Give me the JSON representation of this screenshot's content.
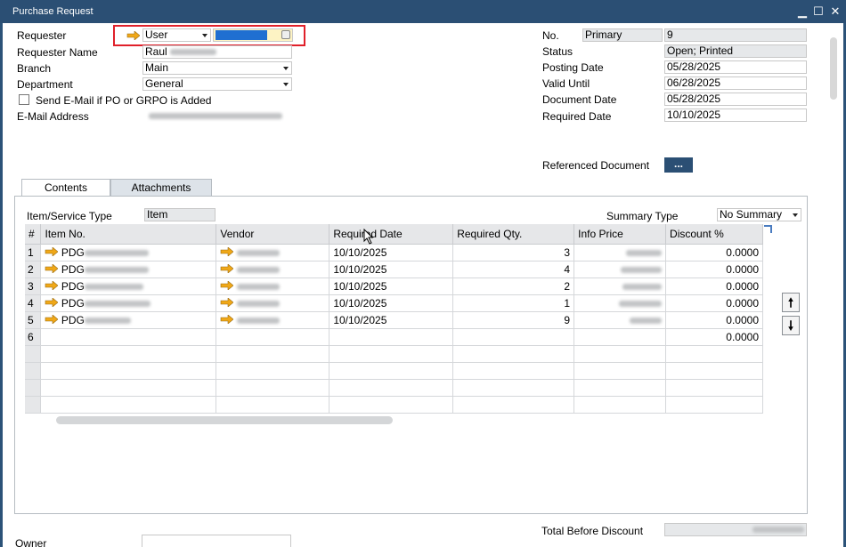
{
  "window": {
    "title": "Purchase Request",
    "minimize": "▁",
    "maximize": "☐",
    "close": "✕"
  },
  "header_left": {
    "requester_label": "Requester",
    "requester_type": "User",
    "requester_name_label": "Requester Name",
    "requester_name": "Raul",
    "branch_label": "Branch",
    "branch": "Main",
    "department_label": "Department",
    "department": "General",
    "send_email_label": "Send E-Mail if PO or GRPO is Added",
    "email_label": "E-Mail Address"
  },
  "header_right": {
    "no_label": "No.",
    "series": "Primary",
    "no": "9",
    "status_label": "Status",
    "status": "Open; Printed",
    "posting_date_label": "Posting Date",
    "posting_date": "05/28/2025",
    "valid_until_label": "Valid Until",
    "valid_until": "06/28/2025",
    "document_date_label": "Document Date",
    "document_date": "05/28/2025",
    "required_date_label": "Required Date",
    "required_date": "10/10/2025",
    "ref_doc_label": "Referenced Document",
    "ref_doc_button": "..."
  },
  "tabs": [
    {
      "label": "Contents"
    },
    {
      "label": "Attachments"
    }
  ],
  "contents": {
    "item_type_label": "Item/Service Type",
    "item_type": "Item",
    "summary_type_label": "Summary Type",
    "summary_type": "No Summary",
    "columns": [
      "#",
      "Item No.",
      "Vendor",
      "Required Date",
      "Required Qty.",
      "Info Price",
      "Discount %"
    ],
    "rows": [
      {
        "n": "1",
        "item": "PDG",
        "date": "10/10/2025",
        "qty": "3",
        "discount": "0.0000"
      },
      {
        "n": "2",
        "item": "PDG",
        "date": "10/10/2025",
        "qty": "4",
        "discount": "0.0000"
      },
      {
        "n": "3",
        "item": "PDG",
        "date": "10/10/2025",
        "qty": "2",
        "discount": "0.0000"
      },
      {
        "n": "4",
        "item": "PDG",
        "date": "10/10/2025",
        "qty": "1",
        "discount": "0.0000"
      },
      {
        "n": "5",
        "item": "PDG",
        "date": "10/10/2025",
        "qty": "9",
        "discount": "0.0000"
      },
      {
        "n": "6",
        "item": "",
        "date": "",
        "qty": "",
        "discount": "0.0000"
      }
    ]
  },
  "footer": {
    "owner_label": "Owner",
    "total_label": "Total Before Discount"
  },
  "colors": {
    "titlebar": "#2b4f74",
    "highlight": "#e0202a",
    "selection": "#1f6fd1",
    "arrow": "#f0a818"
  }
}
